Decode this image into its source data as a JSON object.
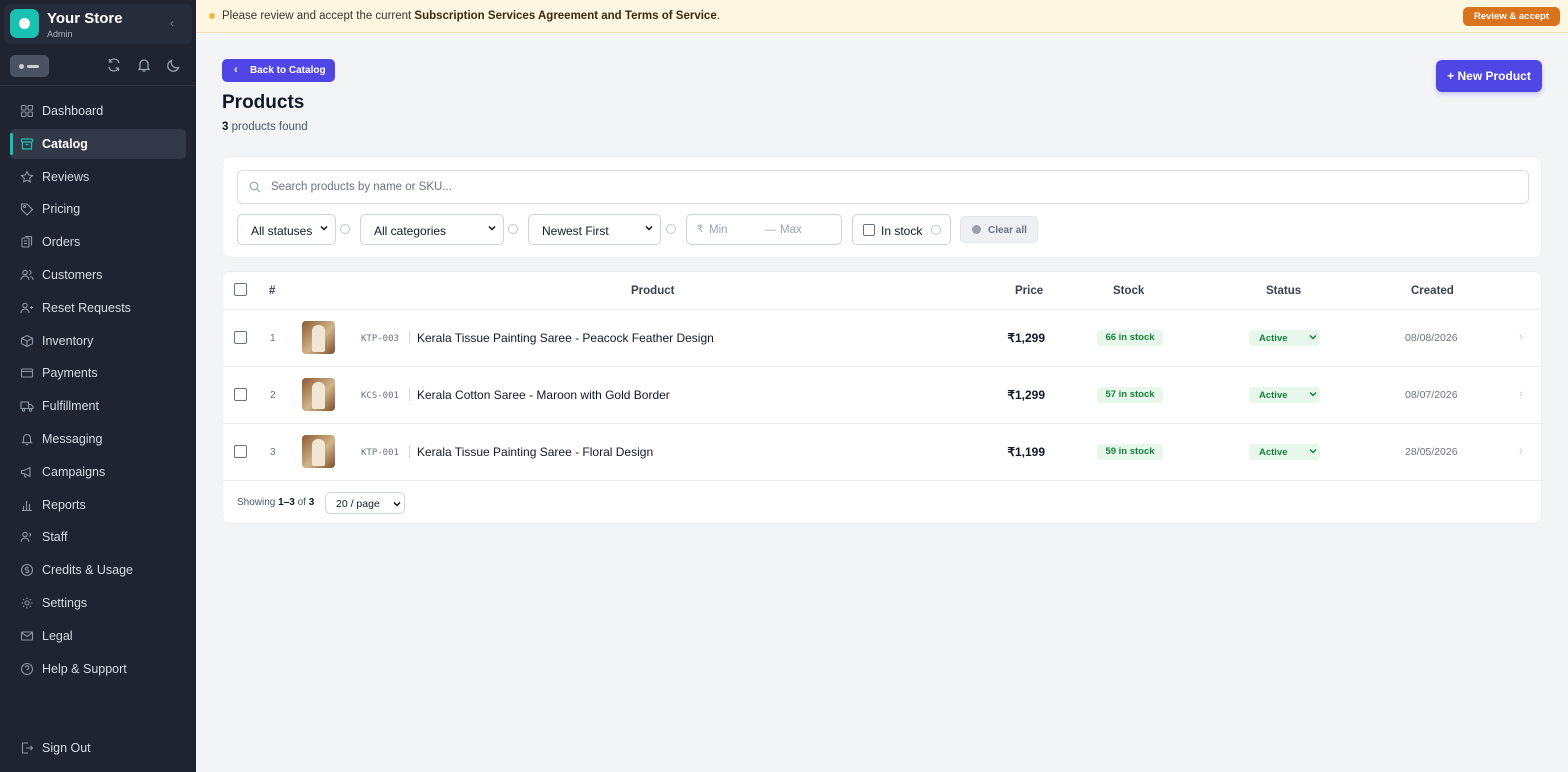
{
  "brand": {
    "name": "Your Store",
    "role": "Admin"
  },
  "nav": [
    {
      "label": "Dashboard",
      "icon": "dashboard-icon"
    },
    {
      "label": "Catalog",
      "icon": "catalog-icon",
      "active": true
    },
    {
      "label": "Reviews",
      "icon": "star-icon"
    },
    {
      "label": "Pricing",
      "icon": "tag-icon"
    },
    {
      "label": "Orders",
      "icon": "orders-icon"
    },
    {
      "label": "Customers",
      "icon": "users-icon"
    },
    {
      "label": "Reset Requests",
      "icon": "reset-icon"
    },
    {
      "label": "Inventory",
      "icon": "box-icon"
    },
    {
      "label": "Payments",
      "icon": "card-icon"
    },
    {
      "label": "Fulfillment",
      "icon": "truck-icon"
    },
    {
      "label": "Messaging",
      "icon": "bell-icon"
    },
    {
      "label": "Campaigns",
      "icon": "megaphone-icon"
    },
    {
      "label": "Reports",
      "icon": "chart-icon"
    },
    {
      "label": "Staff",
      "icon": "staff-icon"
    },
    {
      "label": "Credits & Usage",
      "icon": "coin-icon"
    },
    {
      "label": "Settings",
      "icon": "gear-icon"
    },
    {
      "label": "Legal",
      "icon": "mail-icon"
    },
    {
      "label": "Help & Support",
      "icon": "help-icon"
    }
  ],
  "signout": "Sign Out",
  "banner": {
    "prefix": "Please review and accept the current ",
    "bold": "Subscription Services Agreement and Terms of Service",
    "suffix": ".",
    "button": "Review & accept"
  },
  "header": {
    "back": "Back to Catalog",
    "title": "Products",
    "count": "3",
    "count_suffix": " products found",
    "new_button": "+ New Product"
  },
  "filters": {
    "search_placeholder": "Search products by name or SKU...",
    "status": "All statuses",
    "category": "All categories",
    "sort": "Newest First",
    "currency": "₹",
    "min": "Min",
    "dash": "—",
    "max": "Max",
    "instock": "In stock",
    "clear": "Clear all"
  },
  "table": {
    "headers": {
      "num": "#",
      "product": "Product",
      "price": "Price",
      "stock": "Stock",
      "status": "Status",
      "created": "Created"
    },
    "rows": [
      {
        "num": "1",
        "sku": "KTP-003",
        "name": "Kerala Tissue Painting Saree - Peacock Feather Design",
        "price": "₹1,299",
        "stock": "66 in stock",
        "status": "Active",
        "created": "08/08/2026"
      },
      {
        "num": "2",
        "sku": "KCS-001",
        "name": "Kerala Cotton Saree - Maroon with Gold Border",
        "price": "₹1,299",
        "stock": "57 in stock",
        "status": "Active",
        "created": "08/07/2026"
      },
      {
        "num": "3",
        "sku": "KTP-001",
        "name": "Kerala Tissue Painting Saree - Floral Design",
        "price": "₹1,199",
        "stock": "59 in stock",
        "status": "Active",
        "created": "28/05/2026"
      }
    ],
    "footer": {
      "showing": "Showing ",
      "range": "1–3",
      "of": " of ",
      "total": "3",
      "page_size": "20 / page"
    }
  },
  "colors": {
    "accent": "#4f46e5",
    "brand": "#19c2b0",
    "sidebar": "#1f2430",
    "banner_button": "#d9731c",
    "success": "#16803a"
  }
}
